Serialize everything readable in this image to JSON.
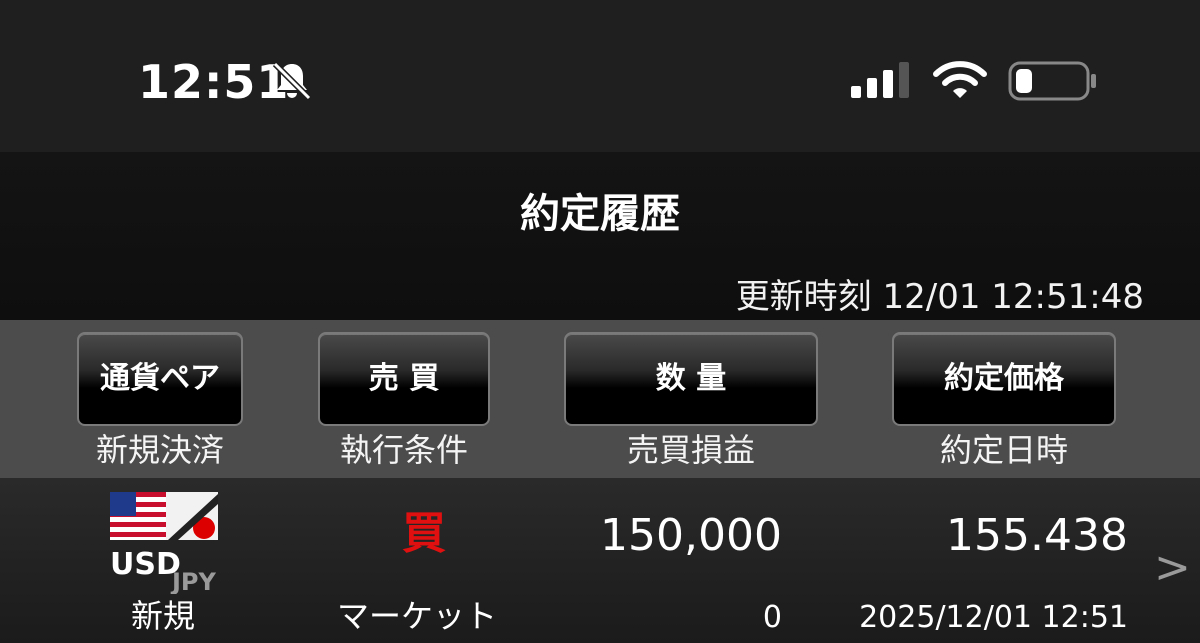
{
  "status_bar": {
    "time": "12:51",
    "icons": [
      "bell-slash-icon",
      "cellular-signal-icon",
      "wifi-icon",
      "battery-icon"
    ]
  },
  "header": {
    "title": "約定履歴",
    "update_time": "更新時刻 12/01 12:51:48"
  },
  "columns": [
    {
      "button": "通貨ペア",
      "sub": "新規決済"
    },
    {
      "button": "売 買",
      "sub": "執行条件"
    },
    {
      "button": "数 量",
      "sub": "売買損益"
    },
    {
      "button": "約定価格",
      "sub": "約定日時"
    }
  ],
  "row": {
    "pair_base": "USD",
    "pair_quote": "JPY",
    "type": "新規",
    "side": "買",
    "condition": "マーケット",
    "quantity": "150,000",
    "pnl": "0",
    "price": "155.438",
    "datetime": "2025/12/01 12:51",
    "chevron": ">"
  },
  "colors": {
    "buy": "#e01010",
    "panel": "#4c4c4c",
    "status_bar": "#1f1f1f"
  }
}
